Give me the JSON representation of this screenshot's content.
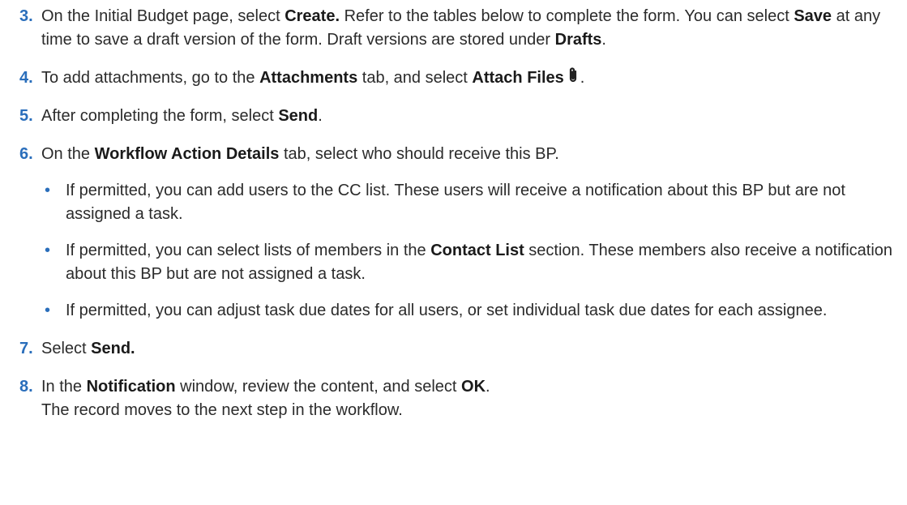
{
  "steps": [
    {
      "number": "3.",
      "parts": [
        {
          "t": "On the Initial Budget page, select "
        },
        {
          "t": "Create.",
          "b": true
        },
        {
          "t": " Refer to the tables below to complete the form. You can select "
        },
        {
          "t": "Save",
          "b": true
        },
        {
          "t": " at any time to save a draft version of the form. Draft versions are stored under "
        },
        {
          "t": "Drafts",
          "b": true
        },
        {
          "t": "."
        }
      ]
    },
    {
      "number": "4.",
      "parts": [
        {
          "t": "To add attachments, go to the "
        },
        {
          "t": "Attachments",
          "b": true
        },
        {
          "t": " tab, and select "
        },
        {
          "t": "Attach Files",
          "b": true
        },
        {
          "icon": "paperclip-icon"
        },
        {
          "t": "."
        }
      ]
    },
    {
      "number": "5.",
      "parts": [
        {
          "t": "After completing the form, select "
        },
        {
          "t": "Send",
          "b": true
        },
        {
          "t": "."
        }
      ]
    },
    {
      "number": "6.",
      "parts": [
        {
          "t": "On the "
        },
        {
          "t": "Workflow Action Details",
          "b": true
        },
        {
          "t": " tab, select who should receive this BP."
        }
      ],
      "bullet_char": "•",
      "bullets": [
        [
          {
            "t": "If permitted, you can add users to the CC list. These users will receive a notification about this BP but are not assigned a task."
          }
        ],
        [
          {
            "t": "If permitted, you can select lists of members in the "
          },
          {
            "t": "Contact List",
            "b": true
          },
          {
            "t": " section. These members also receive a notification about this BP but are not assigned a task."
          }
        ],
        [
          {
            "t": "If permitted, you can adjust task due dates for all users, or set individual task due dates for each assignee."
          }
        ]
      ]
    },
    {
      "number": "7.",
      "parts": [
        {
          "t": "Select "
        },
        {
          "t": "Send.",
          "b": true
        }
      ]
    },
    {
      "number": "8.",
      "parts": [
        {
          "t": "In the "
        },
        {
          "t": "Notification",
          "b": true
        },
        {
          "t": " window, review the content, and select "
        },
        {
          "t": "OK",
          "b": true
        },
        {
          "t": "."
        },
        {
          "br": true
        },
        {
          "t": "The record moves to the next step in the workflow."
        }
      ]
    }
  ],
  "colors": {
    "step_number": "#2a6ebb",
    "text": "#2b2b2b"
  }
}
